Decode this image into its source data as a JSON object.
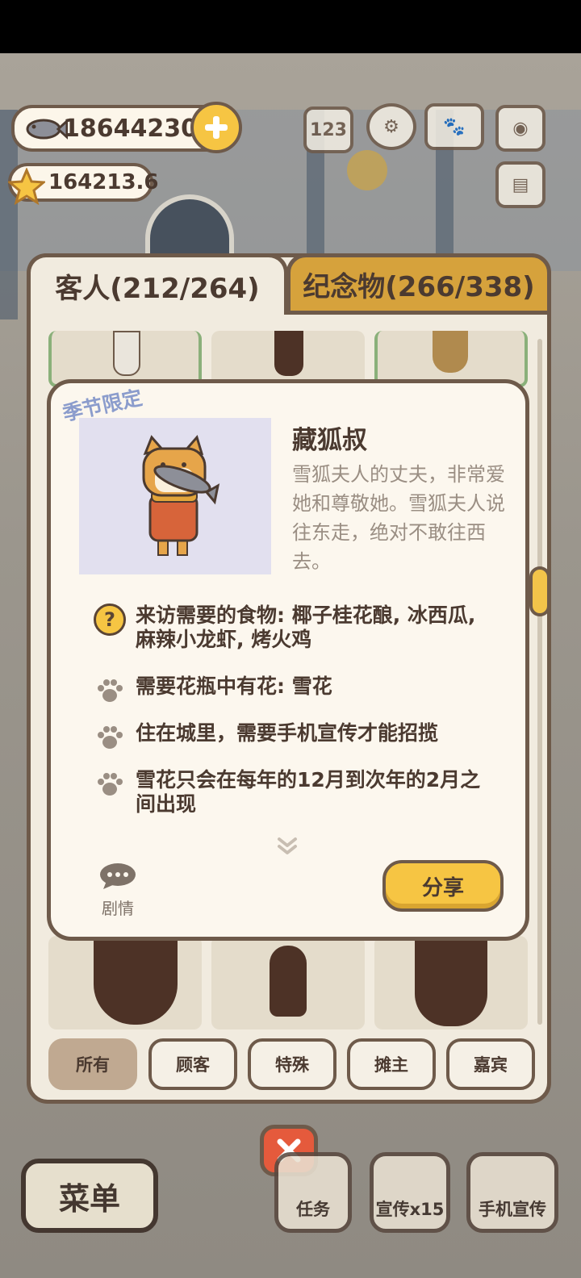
{
  "currency": {
    "fish": "18644230",
    "stars": "164213.6"
  },
  "tabs": {
    "guests": "客人(212/264)",
    "souvenirs": "纪念物(266/338)"
  },
  "detail": {
    "badge": "季节限定",
    "name": "藏狐叔",
    "description": "雪狐夫人的丈夫，非常爱她和尊敬她。雪狐夫人说往东走，绝对不敢往西去。",
    "requirements": [
      "来访需要的食物: 椰子桂花酿, 冰西瓜, 麻辣小龙虾, 烤火鸡",
      "需要花瓶中有花: 雪花",
      "住在城里，需要手机宣传才能招揽",
      "雪花只会在每年的12月到次年的2月之间出现"
    ],
    "story_label": "剧情",
    "share_label": "分享"
  },
  "filters": [
    "所有",
    "顾客",
    "特殊",
    "摊主",
    "嘉宾"
  ],
  "bottom_bar": {
    "menu": "菜单",
    "tasks": "任务",
    "promo": "宣传x15",
    "phone_promo": "手机宣传"
  },
  "colors": {
    "panel_bg": "#f1ebdf",
    "border": "#6e5a4a",
    "accent_yellow": "#f6c543",
    "tab_gold": "#d6a23c",
    "close_red": "#e55a3c",
    "badge_blue": "#8b9ccc",
    "silhouette": "#4d3226"
  }
}
